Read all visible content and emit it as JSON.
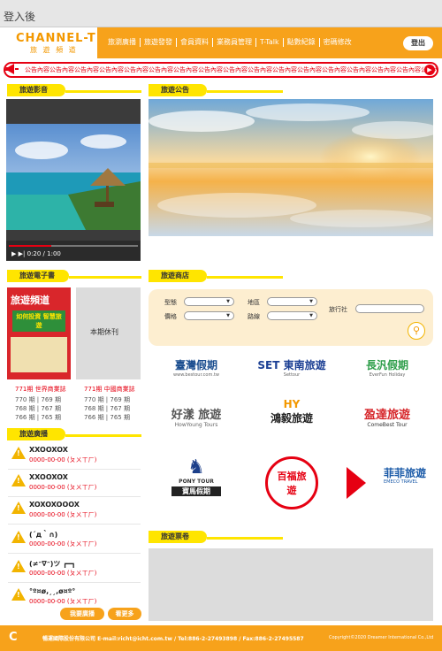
{
  "page": {
    "title": "登入後"
  },
  "header": {
    "logo_main": "CHANNEL-T",
    "logo_sub": "旅 遊 頻 道",
    "nav": [
      "旅瀏廣播",
      "旅遊發發",
      "會員資料",
      "業務員管理",
      "T-Talk",
      "點數紀錄",
      "密碼修改"
    ],
    "logout": "登出"
  },
  "announcement": {
    "text": "公告內容公告內容公告內容公告內容公告內容公告內容公告內容公告內容公告內容公告內容公告內容公告內容公告內容公告內容公告內容公告內容公告內容公告內容公告內容公告內容公告內容公告內容"
  },
  "sections": {
    "video": "旅遊影音",
    "announce": "旅遊公告",
    "ebook": "旅遊電子書",
    "shop": "旅遊商店",
    "ads": "旅遊廣播",
    "tickets": "旅遊票卷"
  },
  "video": {
    "time": "0:20 / 1:00",
    "progress": 0.33
  },
  "ebook": {
    "cover_title": "旅遊頻道",
    "cover_sub": "如何投資 智慧旅遊",
    "off_text": "本期休刊",
    "issues": [
      {
        "title": "771期 世界商業誌",
        "rows": [
          "770 期 | 769 期",
          "768 期 | 767 期",
          "766 期 | 765 期"
        ]
      },
      {
        "title": "771期 中國商業誌",
        "rows": [
          "770 期 | 769 期",
          "768 期 | 767 期",
          "766 期 | 765 期"
        ]
      }
    ]
  },
  "ads": {
    "items": [
      {
        "name": "XXOOXOX",
        "sub": "0000-00-00 (ㄆㄨㄒㄏ)"
      },
      {
        "name": "XXOOXOX",
        "sub": "0000-00-00 (ㄆㄨㄒㄏ)"
      },
      {
        "name": "XOXOXOOOX",
        "sub": "0000-00-00 (ㄆㄨㄒㄏ)"
      },
      {
        "name": "(´д｀∩)",
        "sub": "0000-00-00 (ㄆㄨㄒㄏ)"
      },
      {
        "name": "(≠ᵔ∇ᵔ)ツ ┏━┓",
        "sub": "0000-00-00 (ㄆㄨㄒㄏ)"
      },
      {
        "name": "°º¤ø,¸¸,ø¤º°",
        "sub": "0000-00-00 (ㄆㄨㄒㄏ)"
      }
    ],
    "btn_mine": "我要廣播",
    "btn_more": "看更多"
  },
  "shop": {
    "type_label": "型態",
    "region_label": "地區",
    "agency_label": "旅行社",
    "price_label": "價格",
    "route_label": "路線",
    "brands": [
      {
        "name": "臺灣假期",
        "sub": "www.bestour.com.tw",
        "color": "#1a4d8f"
      },
      {
        "name": "SET 東南旅遊",
        "sub": "Settour",
        "color": "#1b3f94"
      },
      {
        "name": "長汎假期",
        "sub": "EverFun Holiday",
        "color": "#2e9e4a"
      },
      {
        "name": "好漾 旅遊",
        "sub": "HowYoung Tours",
        "color": "#555555"
      },
      {
        "name": "鴻毅旅遊",
        "sub": "HY",
        "color": "#222222"
      },
      {
        "name": "盈達旅遊",
        "sub": "ComeBest Tour",
        "color": "#d6262a"
      },
      {
        "name": "寶馬假期",
        "sub": "PONY TOUR",
        "color": "#1c3f8a"
      },
      {
        "name": "百福旅遊",
        "sub": "",
        "color": "#e60012"
      },
      {
        "name": "菲菲旅遊",
        "sub": "EMECO TRAVEL",
        "color": "#1a5aa8"
      }
    ]
  },
  "footer": {
    "text": "暢運國際股份有限公司 E-mail:richt@icht.com.tw / Tel:886-2-27493898 / Fax:886-2-27495587",
    "copy": "Copyright©2020 Dreamer International Co.,Ltd"
  }
}
